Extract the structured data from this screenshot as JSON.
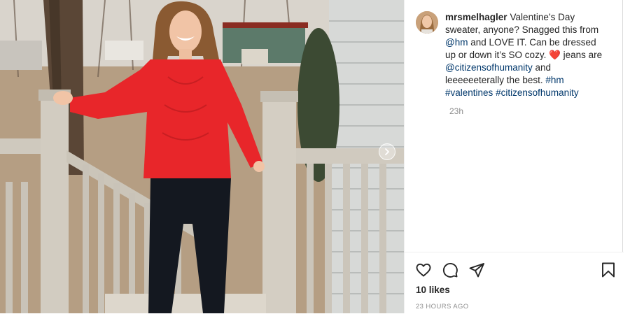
{
  "post": {
    "username": "mrsmelhagler",
    "caption_parts": [
      {
        "type": "text",
        "value": "Valentine’s Day sweater, anyone? Snagged this from "
      },
      {
        "type": "link",
        "value": "@hm"
      },
      {
        "type": "text",
        "value": " and LOVE IT. Can be dressed up or down it’s SO cozy. "
      },
      {
        "type": "emoji",
        "value": "❤️"
      },
      {
        "type": "text",
        "value": " jeans are "
      },
      {
        "type": "link",
        "value": "@citizensofhumanity"
      },
      {
        "type": "text",
        "value": " and leeeeeeterally the best. "
      },
      {
        "type": "link",
        "value": "#hm"
      },
      {
        "type": "text",
        "value": " "
      },
      {
        "type": "link",
        "value": "#valentines"
      },
      {
        "type": "text",
        "value": " "
      },
      {
        "type": "link",
        "value": "#citizensofhumanity"
      }
    ],
    "relative_time": "23h",
    "likes": "10 likes",
    "timestamp": "23 HOURS AGO"
  },
  "icons": {
    "like": "heart-icon",
    "comment": "comment-icon",
    "share": "share-icon",
    "save": "bookmark-icon",
    "next": "chevron-right-icon"
  },
  "colors": {
    "link": "#00376b",
    "text": "#262626",
    "muted": "#8e8e8e",
    "sweater": "#e8262a"
  }
}
